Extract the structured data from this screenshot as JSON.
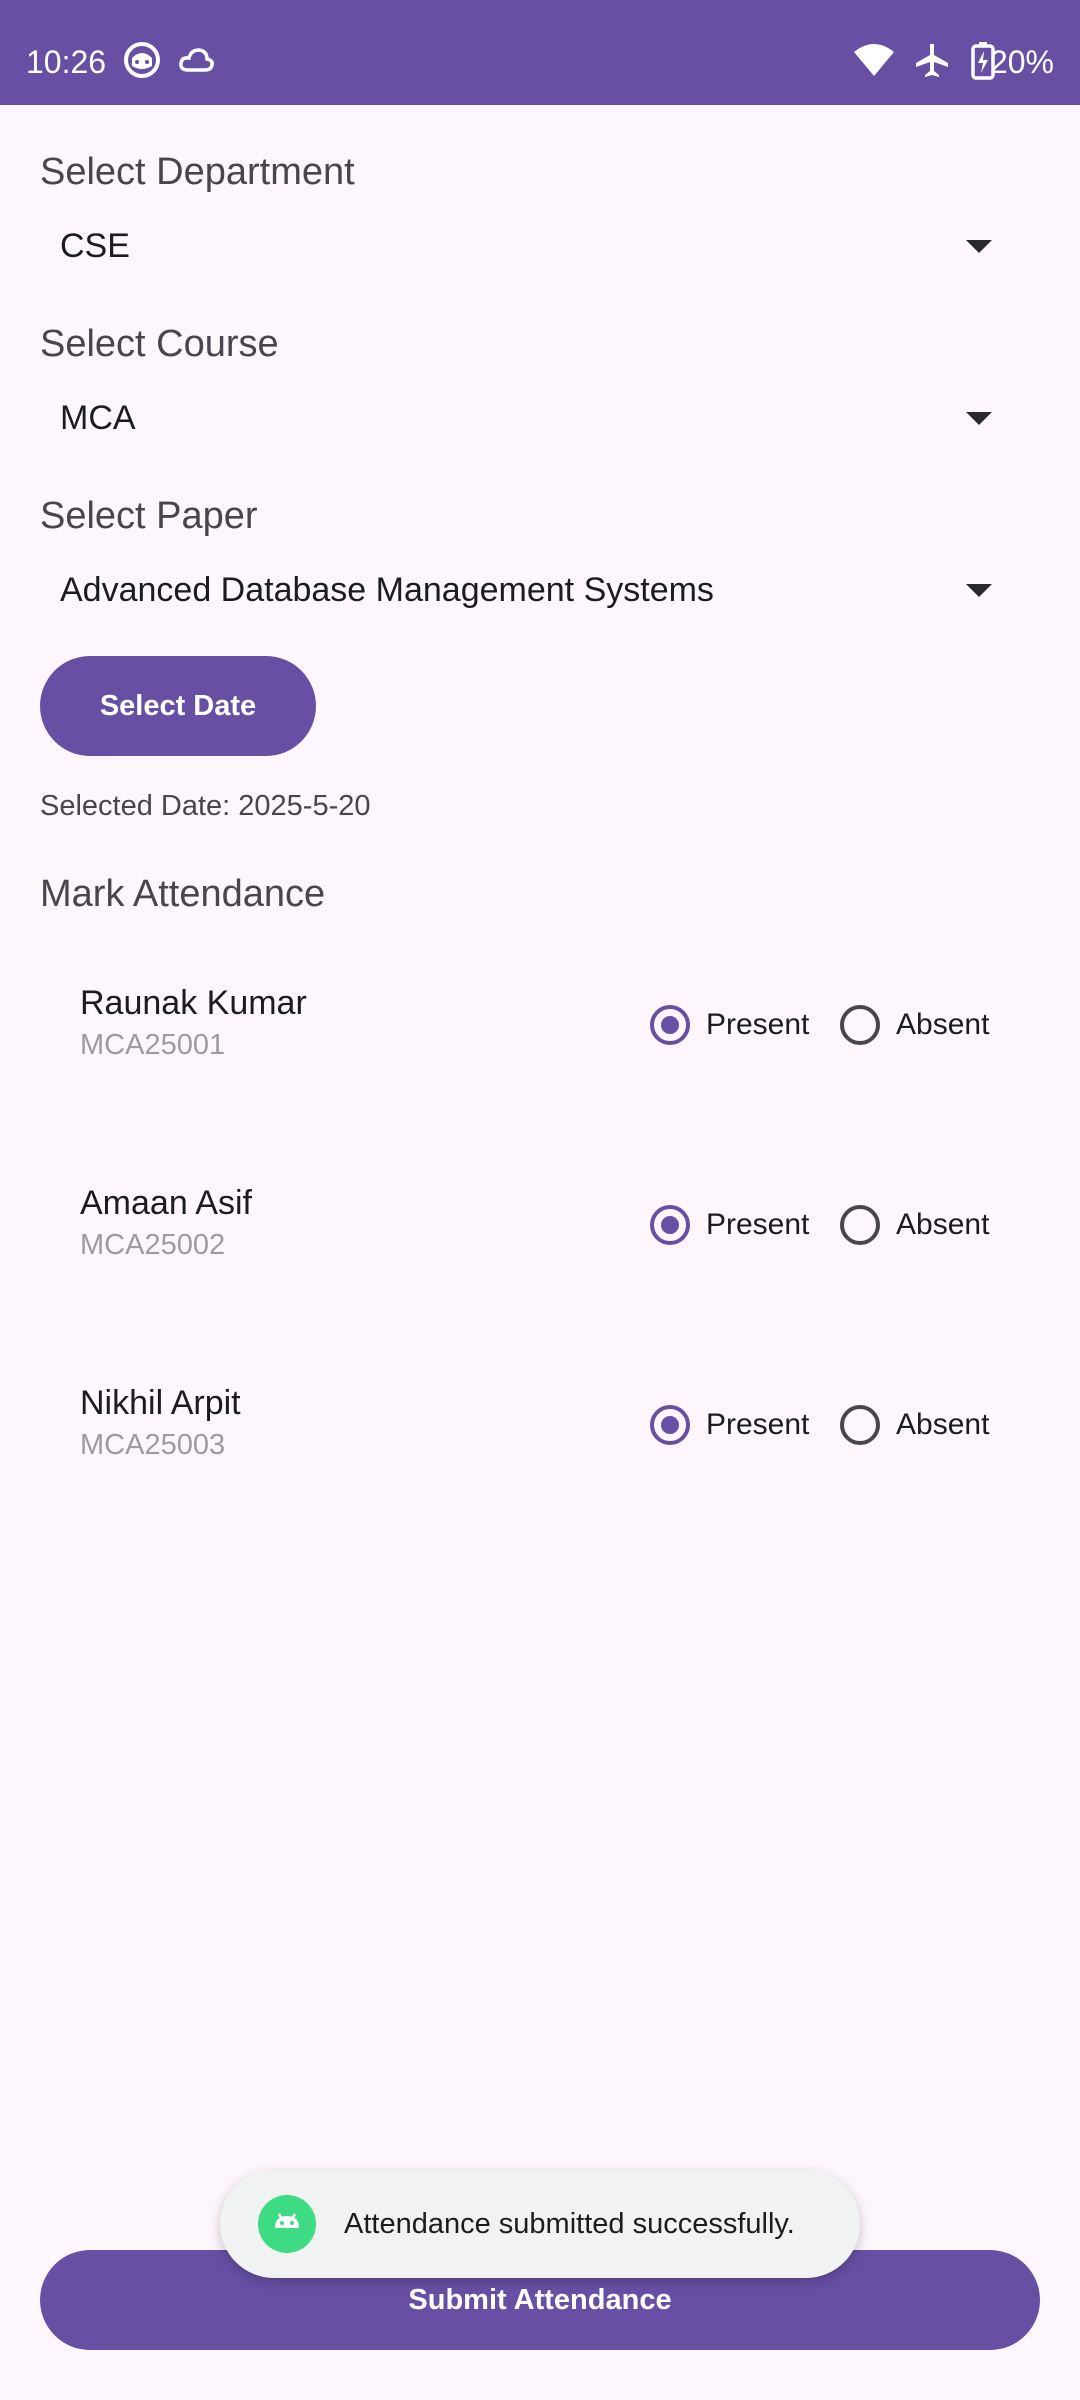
{
  "status_bar": {
    "time": "10:26",
    "battery": "20%",
    "icons": [
      "face-notification-icon",
      "cloud-icon",
      "wifi-icon",
      "airplane-mode-icon",
      "battery-charging-icon"
    ]
  },
  "department": {
    "label": "Select Department",
    "value": "CSE"
  },
  "course": {
    "label": "Select Course",
    "value": "MCA"
  },
  "paper": {
    "label": "Select Paper",
    "value": "Advanced Database Management Systems"
  },
  "date_button": {
    "label": "Select Date"
  },
  "selected_date": "Selected Date: 2025-5-20",
  "attendance": {
    "title": "Mark Attendance",
    "present_label": "Present",
    "absent_label": "Absent",
    "students": [
      {
        "name": "Raunak Kumar",
        "id": "MCA25001",
        "status": "present"
      },
      {
        "name": "Amaan Asif",
        "id": "MCA25002",
        "status": "present"
      },
      {
        "name": "Nikhil Arpit",
        "id": "MCA25003",
        "status": "present"
      }
    ]
  },
  "submit_button": {
    "label": "Submit Attendance"
  },
  "toast": {
    "message": "Attendance submitted successfully.",
    "icon": "android-app-icon"
  },
  "colors": {
    "primary": "#6750A4",
    "background": "#FDF7FD",
    "toast_icon": "#3DDC84"
  }
}
